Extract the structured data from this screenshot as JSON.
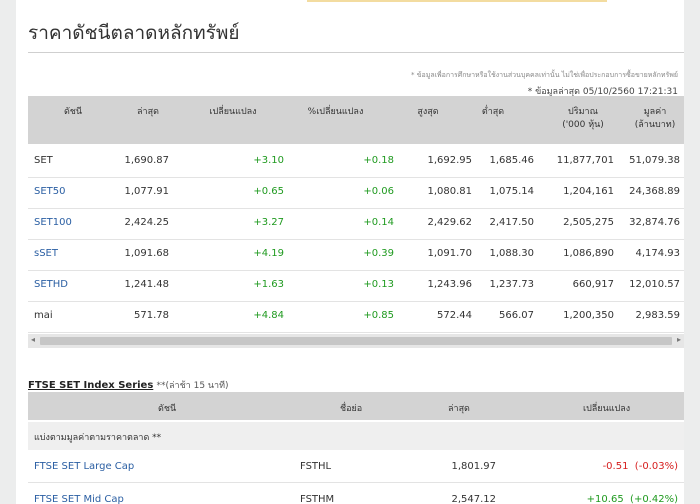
{
  "page_title": "ราคาดัชนีตลาดหลักทรัพย์",
  "note_disclaimer": "* ข้อมูลเพื่อการศึกษาหรือใช้งานส่วนบุคคลเท่านั้น ไม่ใช่เพื่อประกอบการซื้อขายหลักทรัพย์",
  "note_updated": "* ข้อมูลล่าสุด 05/10/2560 17:21:31",
  "columns": {
    "index": "ดัชนี",
    "last": "ล่าสุด",
    "change": "เปลี่ยนแปลง",
    "pct_change": "%เปลี่ยนแปลง",
    "high": "สูงสุด",
    "low": "ต่ำสุด",
    "volume_l1": "ปริมาณ",
    "volume_l2": "('000 หุ้น)",
    "value_l1": "มูลค่า",
    "value_l2": "(ล้านบาท)"
  },
  "rows": [
    {
      "name": "SET",
      "last": "1,690.87",
      "change": "+3.10",
      "pct": "+0.18",
      "high": "1,692.95",
      "low": "1,685.46",
      "volume": "11,877,701",
      "value": "51,079.38"
    },
    {
      "name": "SET50",
      "last": "1,077.91",
      "change": "+0.65",
      "pct": "+0.06",
      "high": "1,080.81",
      "low": "1,075.14",
      "volume": "1,204,161",
      "value": "24,368.89"
    },
    {
      "name": "SET100",
      "last": "2,424.25",
      "change": "+3.27",
      "pct": "+0.14",
      "high": "2,429.62",
      "low": "2,417.50",
      "volume": "2,505,275",
      "value": "32,874.76"
    },
    {
      "name": "sSET",
      "last": "1,091.68",
      "change": "+4.19",
      "pct": "+0.39",
      "high": "1,091.70",
      "low": "1,088.30",
      "volume": "1,086,890",
      "value": "4,174.93"
    },
    {
      "name": "SETHD",
      "last": "1,241.48",
      "change": "+1.63",
      "pct": "+0.13",
      "high": "1,243.96",
      "low": "1,237.73",
      "volume": "660,917",
      "value": "12,010.57"
    },
    {
      "name": "mai",
      "last": "571.78",
      "change": "+4.84",
      "pct": "+0.85",
      "high": "572.44",
      "low": "566.07",
      "volume": "1,200,350",
      "value": "2,983.59"
    }
  ],
  "ftse": {
    "title": "FTSE SET Index Series",
    "subtitle": "**(ล่าช้า 15 นาที)",
    "col_index": "ดัชนี",
    "col_symbol": "ชื่อย่อ",
    "col_last": "ล่าสุด",
    "col_change": "เปลี่ยนแปลง",
    "group_label": "แบ่งตามมูลค่าตามราคาตลาด **",
    "rows": [
      {
        "name": "FTSE SET Large Cap",
        "symbol": "FSTHL",
        "last": "1,801.97",
        "change": "-0.51  (-0.03%)"
      },
      {
        "name": "FTSE SET Mid Cap",
        "symbol": "FSTHM",
        "last": "2,547.12",
        "change": "+10.65  (+0.42%)"
      }
    ]
  },
  "colors": {
    "up": "#1f9a1f",
    "down": "#d61e1e",
    "link": "#2b5fa3"
  }
}
